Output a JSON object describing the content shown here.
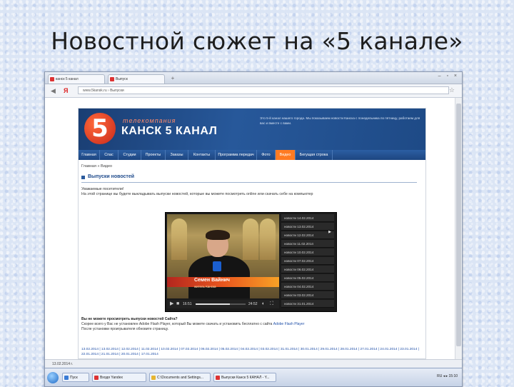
{
  "slide": {
    "title": "Новостной сюжет на «5 канале»"
  },
  "browser": {
    "tabs": [
      {
        "label": "канск 5 канал"
      },
      {
        "label": "Выпуск"
      }
    ],
    "tab_add": "+",
    "window_controls": "– ▫ ×",
    "nav": {
      "back": "◀",
      "yandex_logo": "Я"
    },
    "url": "www.5kansk.ru  ›  Выпуски",
    "star": "☆",
    "status": "13.02.2014 г."
  },
  "site": {
    "logo_digit": "5",
    "logo_sub": "телекомпания",
    "logo_name": "КАНСК 5 КАНАЛ",
    "header_info": "Это 5-й канал нашего города. Мы показываем новости Канска с понедельника по пятницу, работаем для вас и вместе с вами.",
    "nav": [
      "Главная",
      "Спас",
      "Студии",
      "Проекты",
      "Заказы",
      "Контакты",
      "Программа передач",
      "Фото",
      "Видео",
      "Бегущая строка"
    ],
    "breadcrumb": "Главная  »  Видео",
    "section_title": "Выпуски новостей",
    "notice_line1": "Уважаемые посетители!",
    "notice_line2": "На этой странице вы будете выкладывать выпуски новостей, которые вы можете посмотреть online или скачать себе на компьютер",
    "player": {
      "caption_name": "Семен Вайнич",
      "caption_sub": "житель Канска",
      "time_current": "16:51",
      "time_total": "24:52",
      "playlist": [
        "новости 14.02.2014",
        "новости 13.02.2014",
        "новости 12.02.2014",
        "новости 11.02.2014",
        "новости 10.02.2014",
        "новости 07.02.2014",
        "новости 06.02.2014",
        "новости 05.02.2014",
        "новости 04.02.2014",
        "новости 03.02.2014",
        "новости 31.01.2014"
      ],
      "progress_fraction": 0.68
    },
    "faq_question": "Вы не можете просмотреть выпуски новостей Сайта?",
    "faq_answer1": "Скорее всего у Вас не установлен Adobe Flash Player, который Вы можете скачать и установить бесплатно с сайта",
    "faq_link": "Adobe Flash Player",
    "faq_answer2": "После установки проигрывателя обновите страницу.",
    "archive": "13.02.2014 | 13.02.2014 | 12.02.2014 | 11.02.2014 | 10.02.2014 | 07.02.2014 | 06.02.2014 | 05.02.2014 | 04.02.2014 | 03.02.2014 | 31.01.2014 | 30.01.2014 | 29.01.2014 | 28.01.2014 | 27.01.2014 | 24.01.2014 | 23.01.2014 | 22.01.2014 | 21.01.2014 | 20.01.2014 | 17.01.2014"
  },
  "taskbar": {
    "items": [
      "Пуск",
      "Входя Yandex",
      "C:\\Documents and Settings...",
      "Выпуски Канск 5 КАНАЛ - Y..."
    ],
    "tray": "RU  ◂ ▸ 15:10"
  }
}
